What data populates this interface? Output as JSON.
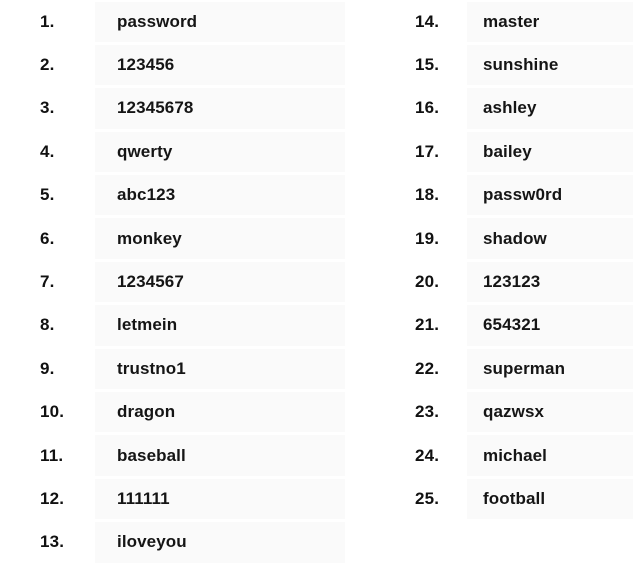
{
  "page": {
    "background_color": "#ffffff",
    "row_band_color": "#fafafa",
    "text_color": "#111111"
  },
  "list": {
    "total_items": 25,
    "columns": [
      {
        "id": "column-left",
        "items": [
          {
            "rank": "1.",
            "password": "password"
          },
          {
            "rank": "2.",
            "password": "123456"
          },
          {
            "rank": "3.",
            "password": "12345678"
          },
          {
            "rank": "4.",
            "password": "qwerty"
          },
          {
            "rank": "5.",
            "password": "abc123"
          },
          {
            "rank": "6.",
            "password": "monkey"
          },
          {
            "rank": "7.",
            "password": "1234567"
          },
          {
            "rank": "8.",
            "password": "letmein"
          },
          {
            "rank": "9.",
            "password": "trustno1"
          },
          {
            "rank": "10.",
            "password": "dragon"
          },
          {
            "rank": "11.",
            "password": "baseball"
          },
          {
            "rank": "12.",
            "password": "111111"
          },
          {
            "rank": "13.",
            "password": "iloveyou"
          }
        ]
      },
      {
        "id": "column-right",
        "items": [
          {
            "rank": "14.",
            "password": "master"
          },
          {
            "rank": "15.",
            "password": "sunshine"
          },
          {
            "rank": "16.",
            "password": "ashley"
          },
          {
            "rank": "17.",
            "password": "bailey"
          },
          {
            "rank": "18.",
            "password": "passw0rd"
          },
          {
            "rank": "19.",
            "password": "shadow"
          },
          {
            "rank": "20.",
            "password": "123123"
          },
          {
            "rank": "21.",
            "password": "654321"
          },
          {
            "rank": "22.",
            "password": "superman"
          },
          {
            "rank": "23.",
            "password": "qazwsx"
          },
          {
            "rank": "24.",
            "password": "michael"
          },
          {
            "rank": "25.",
            "password": "football"
          }
        ]
      }
    ]
  }
}
